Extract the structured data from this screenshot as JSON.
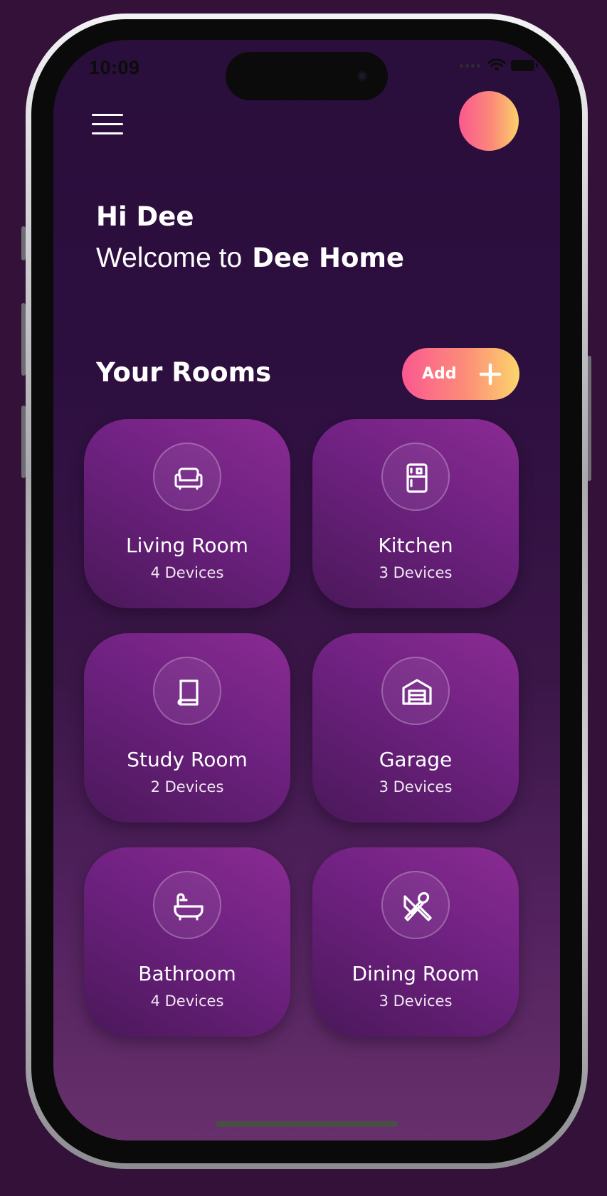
{
  "status_bar": {
    "time": "10:09"
  },
  "header": {
    "greeting": "Hi Dee",
    "welcome_prefix": "Welcome to",
    "home_name": "Dee Home"
  },
  "rooms_section": {
    "title": "Your Rooms",
    "add_label": "Add"
  },
  "rooms": [
    {
      "name": "Living Room",
      "devices": "4 Devices",
      "icon": "sofa-icon"
    },
    {
      "name": "Kitchen",
      "devices": "3 Devices",
      "icon": "fridge-icon"
    },
    {
      "name": "Study Room",
      "devices": "2 Devices",
      "icon": "book-icon"
    },
    {
      "name": "Garage",
      "devices": "3 Devices",
      "icon": "garage-icon"
    },
    {
      "name": "Bathroom",
      "devices": "4 Devices",
      "icon": "bathtub-icon"
    },
    {
      "name": "Dining Room",
      "devices": "3 Devices",
      "icon": "utensils-icon"
    }
  ],
  "colors": {
    "background": "#341139",
    "accent_gradient_start": "#fb5890",
    "accent_gradient_end": "#fcd56b",
    "card": "#7a2588"
  }
}
